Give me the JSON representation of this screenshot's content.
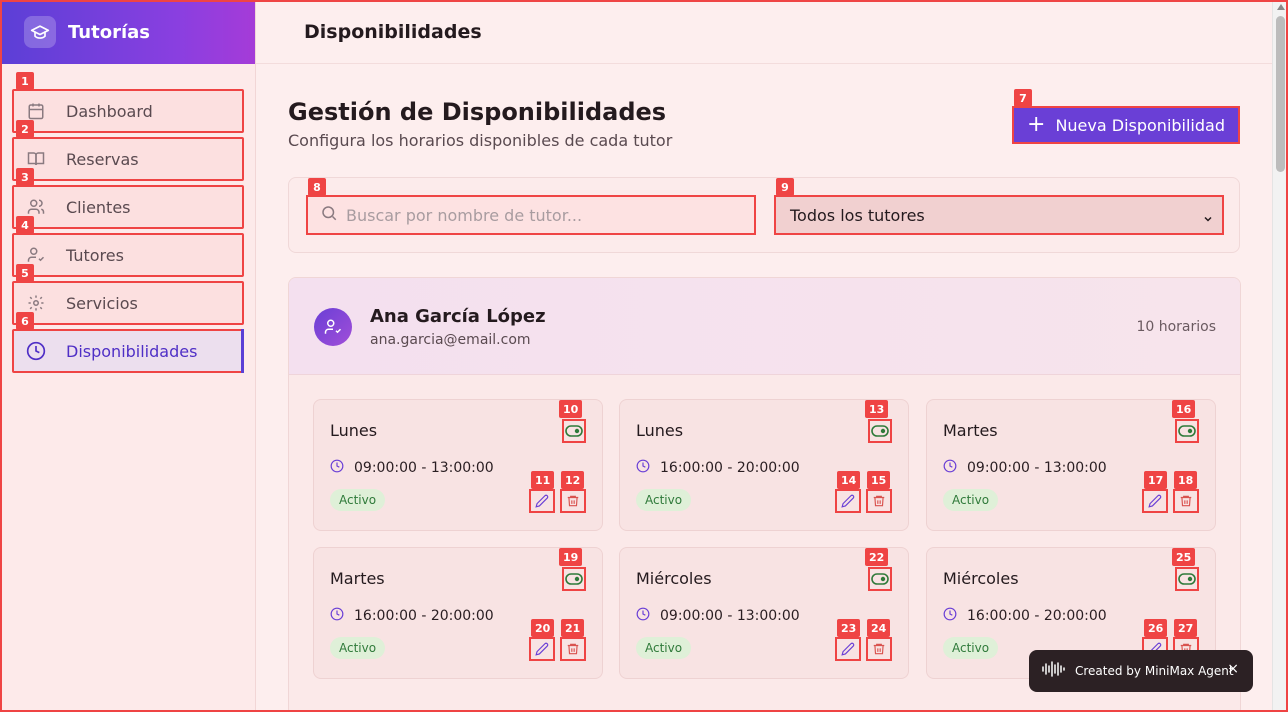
{
  "app": {
    "title": "Tutorías"
  },
  "sidebar": {
    "items": [
      {
        "label": "Dashboard",
        "badge": "1",
        "icon": "calendar-icon"
      },
      {
        "label": "Reservas",
        "badge": "2",
        "icon": "book-open-icon"
      },
      {
        "label": "Clientes",
        "badge": "3",
        "icon": "users-icon"
      },
      {
        "label": "Tutores",
        "badge": "4",
        "icon": "user-check-icon"
      },
      {
        "label": "Servicios",
        "badge": "5",
        "icon": "settings-icon"
      },
      {
        "label": "Disponibilidades",
        "badge": "6",
        "icon": "clock-icon",
        "active": true
      }
    ]
  },
  "header": {
    "title": "Disponibilidades"
  },
  "main": {
    "title": "Gestión de Disponibilidades",
    "subtitle": "Configura los horarios disponibles de cada tutor",
    "new_button": {
      "label": "Nueva Disponibilidad",
      "badge": "7"
    },
    "search": {
      "placeholder": "Buscar por nombre de tutor...",
      "value": "",
      "badge": "8"
    },
    "tutor_filter": {
      "selected": "Todos los tutores",
      "badge": "9"
    }
  },
  "tutor": {
    "name": "Ana García López",
    "email": "ana.garcia@email.com",
    "count": "10 horarios"
  },
  "slots": [
    {
      "day": "Lunes",
      "time": "09:00:00 - 13:00:00",
      "status": "Activo",
      "toggle_badge": "10",
      "edit_badge": "11",
      "delete_badge": "12"
    },
    {
      "day": "Lunes",
      "time": "16:00:00 - 20:00:00",
      "status": "Activo",
      "toggle_badge": "13",
      "edit_badge": "14",
      "delete_badge": "15"
    },
    {
      "day": "Martes",
      "time": "09:00:00 - 13:00:00",
      "status": "Activo",
      "toggle_badge": "16",
      "edit_badge": "17",
      "delete_badge": "18"
    },
    {
      "day": "Martes",
      "time": "16:00:00 - 20:00:00",
      "status": "Activo",
      "toggle_badge": "19",
      "edit_badge": "20",
      "delete_badge": "21"
    },
    {
      "day": "Miércoles",
      "time": "09:00:00 - 13:00:00",
      "status": "Activo",
      "toggle_badge": "22",
      "edit_badge": "23",
      "delete_badge": "24"
    },
    {
      "day": "Miércoles",
      "time": "16:00:00 - 20:00:00",
      "status": "Activo",
      "toggle_badge": "25",
      "edit_badge": "26",
      "delete_badge": "27"
    }
  ],
  "toast": {
    "text": "Created by MiniMax Agent",
    "close": "×"
  },
  "colors": {
    "accent": "#6a3fd6",
    "annotation": "#ef4444",
    "status_active": "#2f7a3a"
  }
}
